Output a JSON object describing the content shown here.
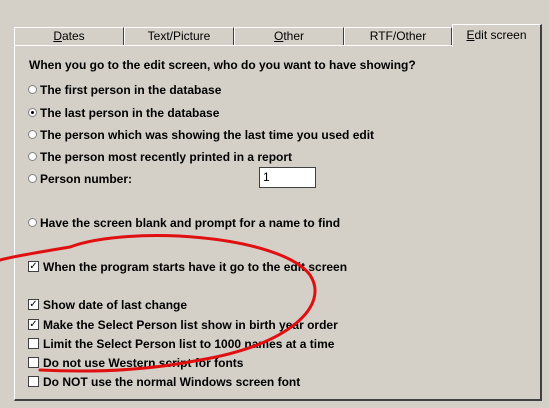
{
  "tabs": [
    {
      "label": "Dates",
      "accesskey": "D"
    },
    {
      "label": "Text/Picture"
    },
    {
      "label": "Other",
      "accesskey": "O"
    },
    {
      "label": "RTF/Other"
    },
    {
      "label": "Edit screen",
      "accesskey": "E",
      "active": true
    }
  ],
  "question": "When you go to the edit screen, who do you want to have showing?",
  "radios": [
    {
      "label": "The first person in the database",
      "selected": false
    },
    {
      "label": "The last person in the database",
      "selected": true
    },
    {
      "label": "The person which was showing the last time you used edit",
      "selected": false
    },
    {
      "label": "The person most recently printed in a report",
      "selected": false
    },
    {
      "label": "Person number:",
      "selected": false
    },
    {
      "label": "Have the screen blank and prompt for a name to find",
      "selected": false
    }
  ],
  "person_number_value": "1",
  "checkboxes": [
    {
      "label": "When the program starts have it go to the edit screen",
      "checked": true
    },
    {
      "label": "Show date of last change",
      "checked": true
    },
    {
      "label": "Make the Select Person list show in birth year order",
      "checked": true
    },
    {
      "label": "Limit the Select Person list to 1000 names at a time",
      "checked": false
    },
    {
      "label": "Do not use Western script for fonts",
      "checked": false
    },
    {
      "label": "Do NOT use the normal Windows screen font",
      "checked": false
    }
  ],
  "colors": {
    "annotation": "#e01010",
    "face": "#d4d0c8"
  }
}
